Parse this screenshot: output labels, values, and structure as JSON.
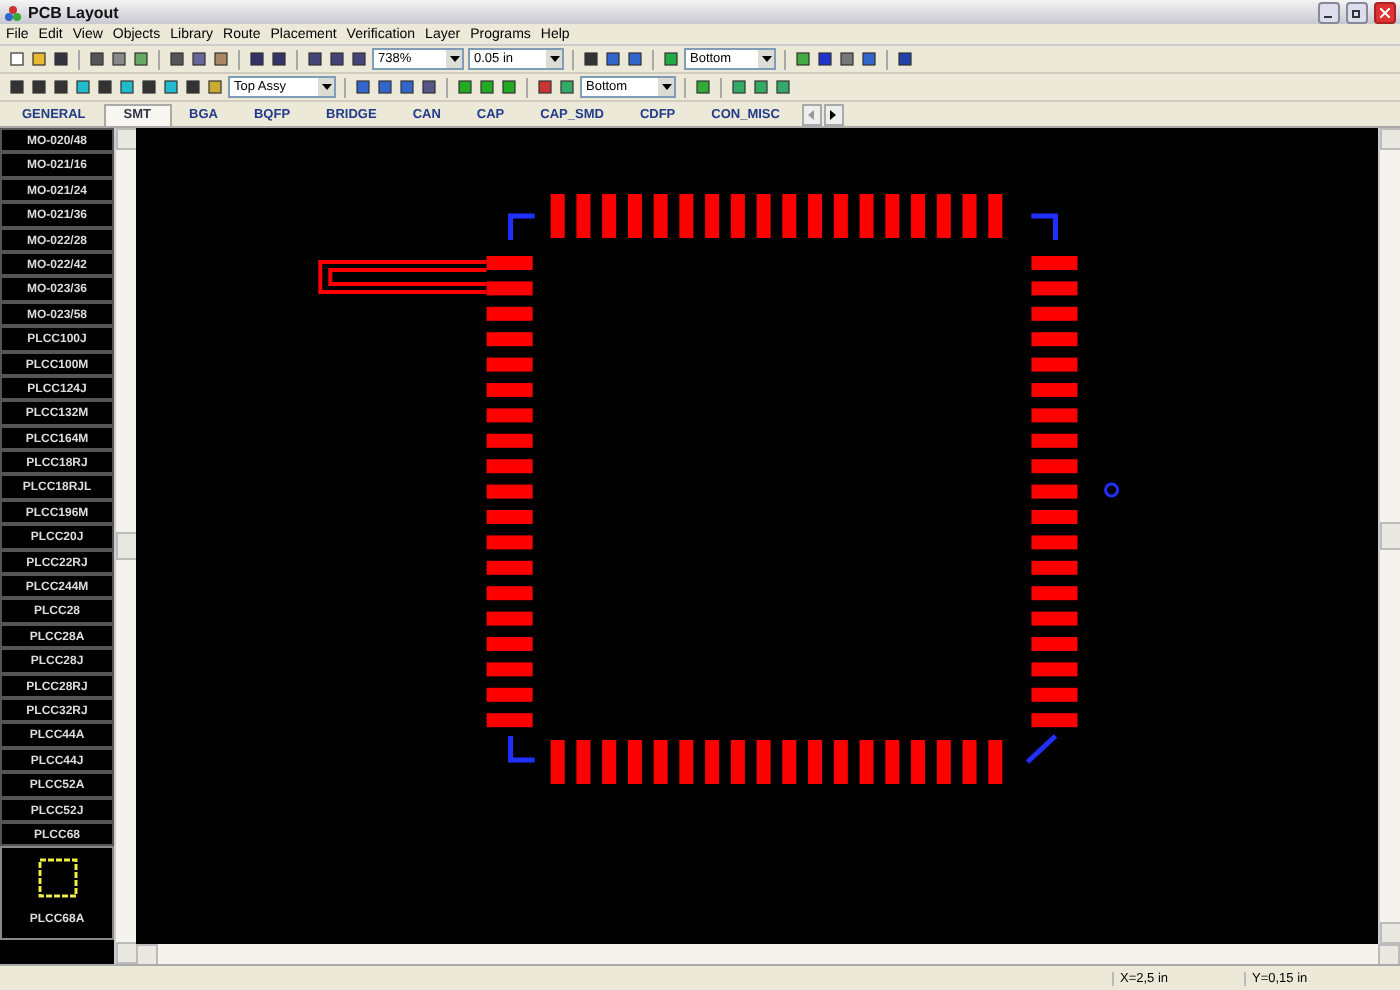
{
  "window": {
    "title": "PCB Layout"
  },
  "menu": [
    "File",
    "Edit",
    "View",
    "Objects",
    "Library",
    "Route",
    "Placement",
    "Verification",
    "Layer",
    "Programs",
    "Help"
  ],
  "toolbar_1": {
    "zoom": "738%",
    "grid": "0.05 in",
    "layer": "Bottom"
  },
  "toolbar_2": {
    "layer": "Top Assy",
    "side": "Bottom"
  },
  "tabs": [
    {
      "label": "GENERAL",
      "selected": false
    },
    {
      "label": "SMT",
      "selected": true
    },
    {
      "label": "BGA",
      "selected": false
    },
    {
      "label": "BQFP",
      "selected": false
    },
    {
      "label": "BRIDGE",
      "selected": false
    },
    {
      "label": "CAN",
      "selected": false
    },
    {
      "label": "CAP",
      "selected": false
    },
    {
      "label": "CAP_SMD",
      "selected": false
    },
    {
      "label": "CDFP",
      "selected": false
    },
    {
      "label": "CON_MISC",
      "selected": false
    }
  ],
  "library": [
    {
      "name": "MO-020/48",
      "selected": false
    },
    {
      "name": "MO-021/16",
      "selected": false
    },
    {
      "name": "MO-021/24",
      "selected": false
    },
    {
      "name": "MO-021/36",
      "selected": false
    },
    {
      "name": "MO-022/28",
      "selected": false
    },
    {
      "name": "MO-022/42",
      "selected": false
    },
    {
      "name": "MO-023/36",
      "selected": false
    },
    {
      "name": "MO-023/58",
      "selected": false
    },
    {
      "name": "PLCC100J",
      "selected": false
    },
    {
      "name": "PLCC100M",
      "selected": false
    },
    {
      "name": "PLCC124J",
      "selected": false
    },
    {
      "name": "PLCC132M",
      "selected": false
    },
    {
      "name": "PLCC164M",
      "selected": false
    },
    {
      "name": "PLCC18RJ",
      "selected": false
    },
    {
      "name": "PLCC18RJL",
      "selected": false
    },
    {
      "name": "PLCC196M",
      "selected": false
    },
    {
      "name": "PLCC20J",
      "selected": false
    },
    {
      "name": "PLCC22RJ",
      "selected": false
    },
    {
      "name": "PLCC244M",
      "selected": false
    },
    {
      "name": "PLCC28",
      "selected": false
    },
    {
      "name": "PLCC28A",
      "selected": false
    },
    {
      "name": "PLCC28J",
      "selected": false
    },
    {
      "name": "PLCC28RJ",
      "selected": false
    },
    {
      "name": "PLCC32RJ",
      "selected": false
    },
    {
      "name": "PLCC44A",
      "selected": false
    },
    {
      "name": "PLCC44J",
      "selected": false
    },
    {
      "name": "PLCC52A",
      "selected": false
    },
    {
      "name": "PLCC52J",
      "selected": false
    },
    {
      "name": "PLCC68",
      "selected": false
    },
    {
      "name": "PLCC68A",
      "selected": true
    }
  ],
  "status_bar": {
    "x": "X=2,5 in",
    "y": "Y=0,15 in"
  }
}
